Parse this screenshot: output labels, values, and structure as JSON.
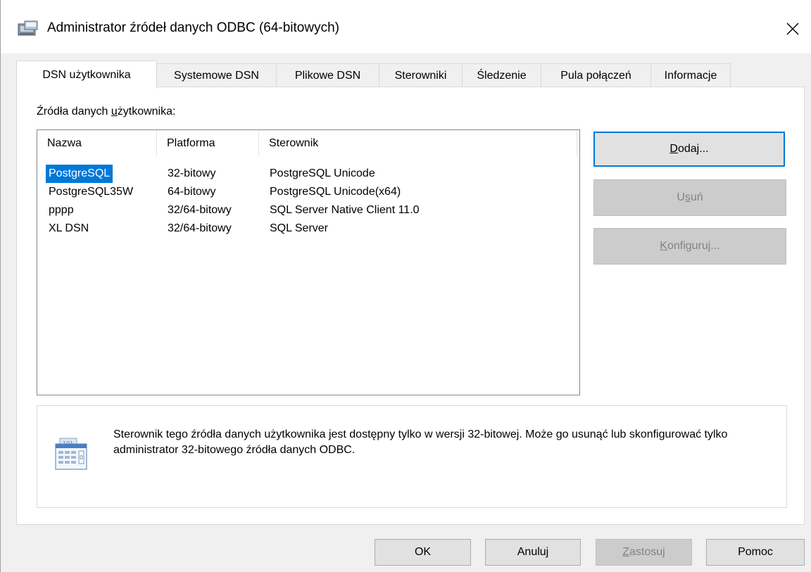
{
  "window": {
    "title": "Administrator źródeł danych ODBC (64-bitowych)",
    "close_glyph": "✕"
  },
  "tabs": [
    {
      "label": "DSN użytkownika",
      "active": true
    },
    {
      "label": "Systemowe DSN"
    },
    {
      "label": "Plikowe DSN"
    },
    {
      "label": "Sterowniki"
    },
    {
      "label": "Śledzenie"
    },
    {
      "label": "Pula połączeń"
    },
    {
      "label": "Informacje"
    }
  ],
  "panel": {
    "section_label_pre": "Źródła danych ",
    "section_label_underlined": "u",
    "section_label_post": "żytkownika:",
    "columns": [
      "Nazwa",
      "Platforma",
      "Sterownik"
    ],
    "rows": [
      {
        "name": "PostgreSQL",
        "platform": "32-bitowy",
        "driver": "PostgreSQL Unicode",
        "selected": true
      },
      {
        "name": "PostgreSQL35W",
        "platform": "64-bitowy",
        "driver": "PostgreSQL Unicode(x64)"
      },
      {
        "name": "pppp",
        "platform": "32/64-bitowy",
        "driver": "SQL Server Native Client 11.0"
      },
      {
        "name": "XL DSN",
        "platform": "32/64-bitowy",
        "driver": "SQL Server"
      }
    ],
    "buttons": {
      "add": {
        "pre": "",
        "u": "D",
        "post": "odaj..."
      },
      "remove": {
        "pre": "U",
        "u": "s",
        "post": "uń"
      },
      "configure": {
        "pre": "",
        "u": "K",
        "post": "onfiguruj..."
      }
    },
    "info_text": "Sterownik tego źródła danych użytkownika jest dostępny tylko w wersji 32-bitowej. Może go usunąć lub skonfigurować tylko administrator 32-bitowego źródła danych ODBC."
  },
  "footer": {
    "ok": "OK",
    "cancel": "Anuluj",
    "apply_u": "Z",
    "apply_post": "astosuj",
    "help": "Pomoc"
  },
  "colors": {
    "selection": "#0078d7",
    "focus_border": "#0078d7"
  }
}
